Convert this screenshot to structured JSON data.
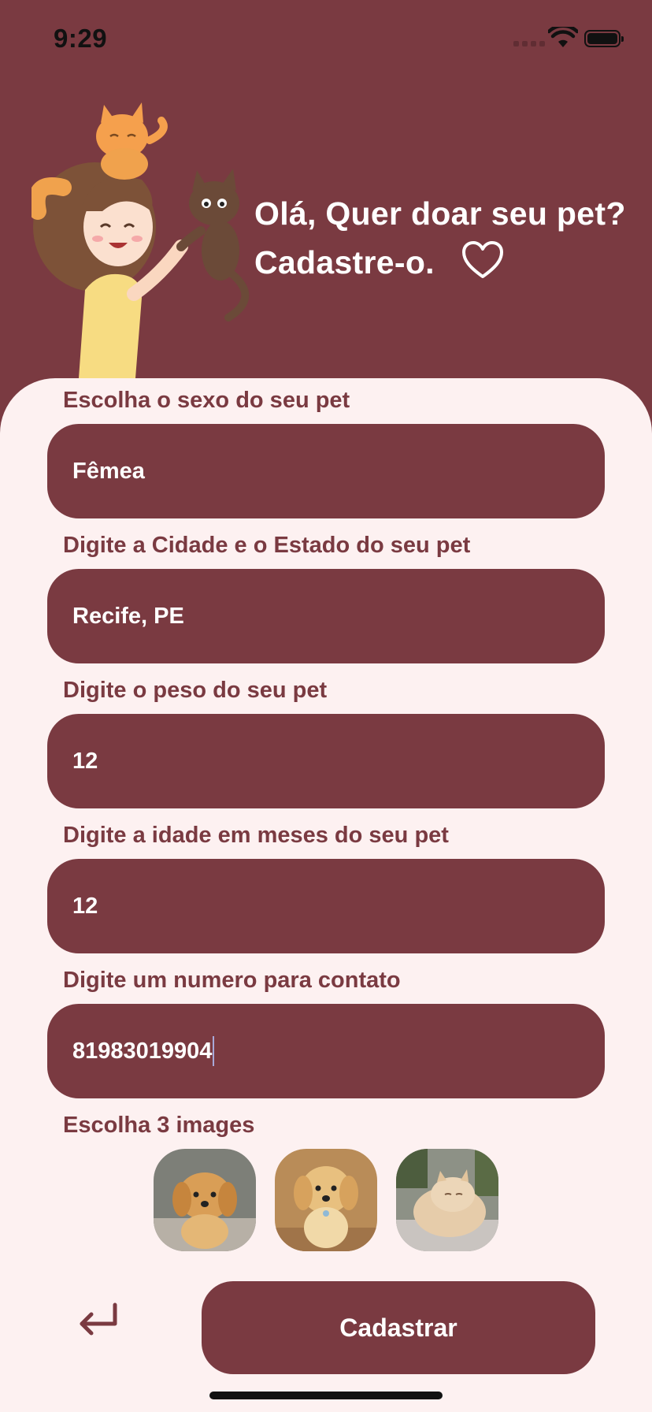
{
  "status_bar": {
    "time": "9:29"
  },
  "header": {
    "line1": "Olá, Quer doar seu pet?",
    "line2": "Cadastre-o."
  },
  "form": {
    "sex": {
      "label": "Escolha o sexo do seu pet",
      "value": "Fêmea"
    },
    "city": {
      "label": "Digite a Cidade e o Estado do seu pet",
      "value": "Recife, PE"
    },
    "weight": {
      "label": "Digite o peso do seu pet",
      "value": "12"
    },
    "age": {
      "label": "Digite a idade em meses do seu pet",
      "value": "12"
    },
    "phone": {
      "label": "Digite um numero para contato",
      "value": "81983019904"
    },
    "images": {
      "label": "Escolha 3 images"
    }
  },
  "actions": {
    "submit_label": "Cadastrar"
  },
  "colors": {
    "primary": "#7a3a41",
    "card_background": "#fdf1f1",
    "text_light": "#ffffff"
  }
}
